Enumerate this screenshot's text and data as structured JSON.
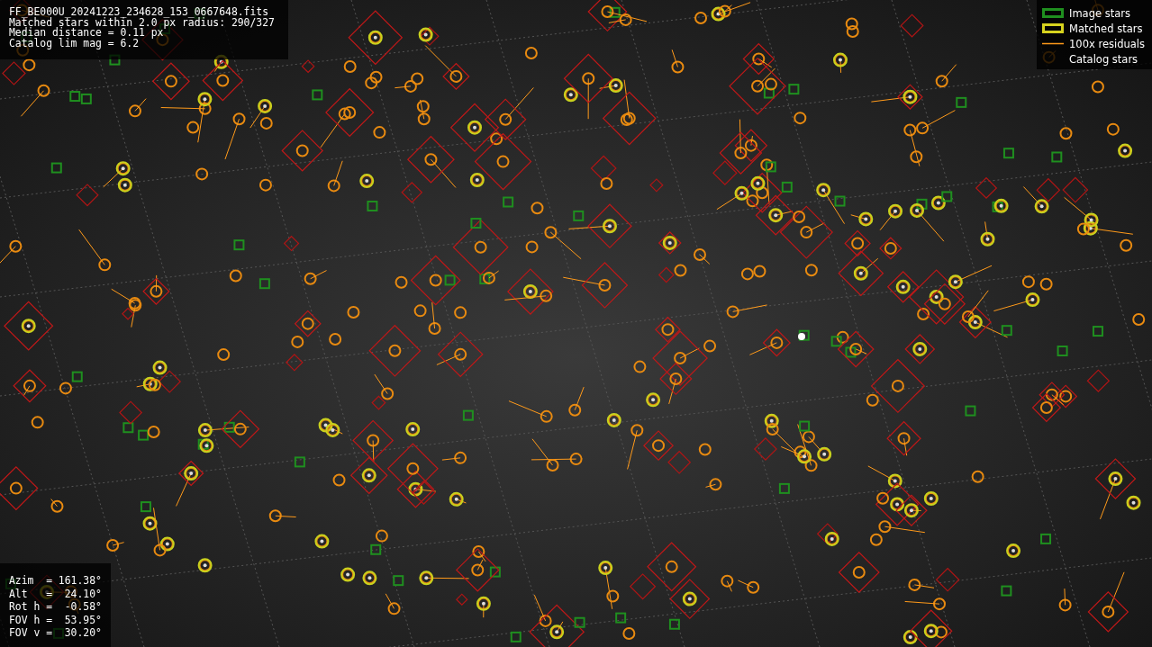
{
  "info": {
    "lines": [
      "FF_BE000U_20241223_234628_153_0667648.fits",
      "Matched stars within 2.0 px radius: 290/327",
      "Median distance = 0.11 px",
      "Catalog lim mag = 6.2"
    ]
  },
  "legend": {
    "items": [
      {
        "label": "Image stars",
        "kind": "box",
        "color": "#1f8f1f"
      },
      {
        "label": "Matched stars",
        "kind": "box",
        "color": "#d6d21e"
      },
      {
        "label": "100x residuals",
        "kind": "line",
        "color": "#ff9a1a"
      },
      {
        "label": "Catalog stars",
        "kind": "none"
      }
    ]
  },
  "pointing": {
    "lines": [
      "Azim  = 161.38°",
      "Alt   =  24.10°",
      "Rot h =  -0.58°",
      "FOV h =  53.95°",
      "FOV v =  30.20°"
    ]
  }
}
